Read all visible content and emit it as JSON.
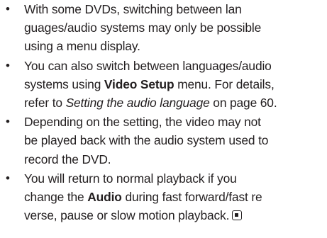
{
  "bullet_glyph": "•",
  "notes": [
    {
      "lines": [
        "With some DVDs, switching between lan",
        "guages/audio systems may only be possible",
        "using a menu display."
      ]
    },
    {
      "line1": "You can also switch between languages/audio",
      "line2_before": "systems using ",
      "line2_bold": "Video Setup",
      "line2_after": " menu. For details,",
      "line3_before": "refer to ",
      "line3_italic": "Setting the audio language",
      "line3_after": " on page 60."
    },
    {
      "lines": [
        "Depending on the setting, the video may not",
        "be played back with the audio system used to",
        "record the DVD."
      ]
    },
    {
      "line1": "You will return to normal playback if you",
      "line2_before": "change the ",
      "line2_bold": "Audio",
      "line2_after": " during fast forward/fast re",
      "line3": "verse, pause or slow motion playback."
    }
  ],
  "end_mark_icon": "stop-square-icon"
}
